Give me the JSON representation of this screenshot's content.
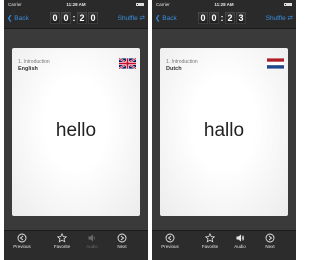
{
  "screens": [
    {
      "status": {
        "carrier": "Carrier",
        "time": "11:28 AM"
      },
      "nav": {
        "back": "Back",
        "timer": {
          "minutes": [
            "0",
            "0"
          ],
          "seconds": [
            "2",
            "0"
          ]
        },
        "shuffle": "Shuffle"
      },
      "card": {
        "lesson": "1. Introduction",
        "language": "English",
        "word": "hello",
        "flag": "uk-flag-icon"
      },
      "toolbar": {
        "previous": "Previous",
        "favorite": "Favorite",
        "audio": "Audio",
        "next": "Next"
      }
    },
    {
      "status": {
        "carrier": "Carrier",
        "time": "11:28 AM"
      },
      "nav": {
        "back": "Back",
        "timer": {
          "minutes": [
            "0",
            "0"
          ],
          "seconds": [
            "2",
            "3"
          ]
        },
        "shuffle": "Shuffle"
      },
      "card": {
        "lesson": "1. Introduction",
        "language": "Dutch",
        "word": "hallo",
        "flag": "netherlands-flag-icon"
      },
      "toolbar": {
        "previous": "Previous",
        "favorite": "Favorite",
        "audio": "Audio",
        "next": "Next"
      }
    }
  ],
  "colors": {
    "accent": "#3b8fe0",
    "background": "#3a3a3a",
    "card": "#ffffff",
    "audio_disabled": "#6a6a6a"
  }
}
